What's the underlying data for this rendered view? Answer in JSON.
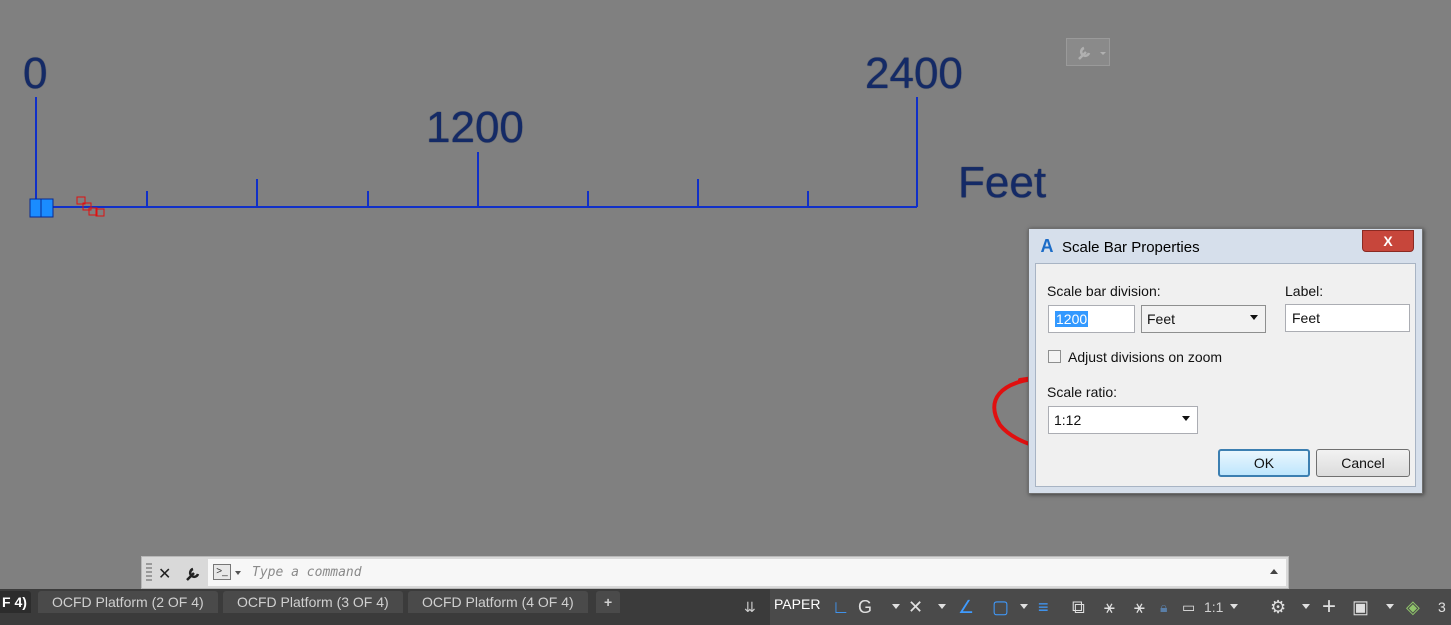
{
  "scale_bar": {
    "labels": [
      "0",
      "1200",
      "2400"
    ],
    "unit": "Feet"
  },
  "dialog": {
    "title": "Scale Bar Properties",
    "close_glyph": "X",
    "division_label": "Scale bar division:",
    "division_value": "1200",
    "unit_selected": "Feet",
    "label_label": "Label:",
    "label_value": "Feet",
    "adjust_checkbox_label": "Adjust divisions on zoom",
    "adjust_checked": false,
    "scale_ratio_label": "Scale ratio:",
    "scale_ratio_value": "1:12",
    "ok": "OK",
    "cancel": "Cancel"
  },
  "command_line": {
    "placeholder": "Type a command",
    "prompt_icon": ">_"
  },
  "status_bar": {
    "tabs": [
      "F 4)",
      "OCFD Platform (2 OF 4)",
      "OCFD Platform (3 OF 4)",
      "OCFD Platform (4 OF 4)"
    ],
    "add_tab": "+",
    "paper": "PAPER",
    "annotation_scale": "1:1",
    "trailing": "3"
  },
  "colors": {
    "background": "#808080",
    "scale_bar_line": "#1030c8",
    "scale_bar_text": "#142a66",
    "annotation_circle": "#e01010"
  }
}
